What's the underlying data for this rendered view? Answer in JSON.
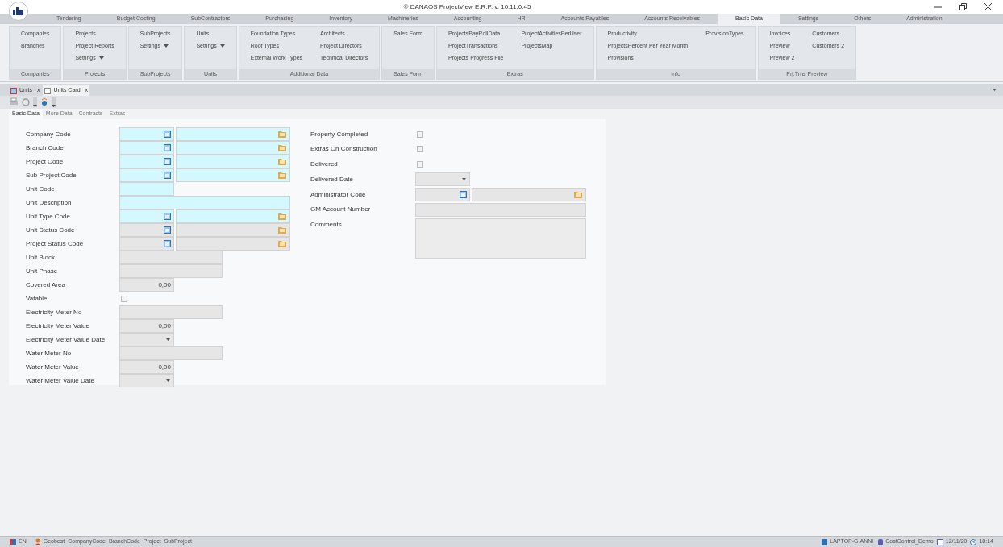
{
  "window": {
    "title": "© DANAOS ProjectView E.R.P. v. 10.11.0.45"
  },
  "menu_tabs": [
    {
      "label": "Tendering",
      "selected": false
    },
    {
      "label": "Budget Costing",
      "selected": false
    },
    {
      "label": "SubContractors",
      "selected": false
    },
    {
      "label": "Purchasing",
      "selected": false
    },
    {
      "label": "Inventory",
      "selected": false
    },
    {
      "label": "Machineries",
      "selected": false
    },
    {
      "label": "Accounting",
      "selected": false
    },
    {
      "label": "HR",
      "selected": false
    },
    {
      "label": "Accounts Payables",
      "selected": false
    },
    {
      "label": "Accounts Receivables",
      "selected": false
    },
    {
      "label": "Basic Data",
      "selected": true
    },
    {
      "label": "Settings",
      "selected": false
    },
    {
      "label": "Others",
      "selected": false
    },
    {
      "label": "Administration",
      "selected": false
    }
  ],
  "ribbon_groups": [
    {
      "label": "Companies",
      "columns": [
        [
          {
            "label": "Companies",
            "dropdown": false
          },
          {
            "label": "Branches",
            "dropdown": false
          }
        ]
      ]
    },
    {
      "label": "Projects",
      "columns": [
        [
          {
            "label": "Projects",
            "dropdown": false
          },
          {
            "label": "Project Reports",
            "dropdown": false
          },
          {
            "label": "Settings",
            "dropdown": true
          }
        ]
      ]
    },
    {
      "label": "SubProjects",
      "columns": [
        [
          {
            "label": "SubProjects",
            "dropdown": false
          },
          {
            "label": "Settings",
            "dropdown": true
          }
        ]
      ]
    },
    {
      "label": "Units",
      "columns": [
        [
          {
            "label": "Units",
            "dropdown": false
          },
          {
            "label": "Settings",
            "dropdown": true
          }
        ]
      ]
    },
    {
      "label": "Additional Data",
      "columns": [
        [
          {
            "label": "Foundation Types",
            "dropdown": false
          },
          {
            "label": "Roof Types",
            "dropdown": false
          },
          {
            "label": "External Work Types",
            "dropdown": false
          }
        ],
        [
          {
            "label": "Architects",
            "dropdown": false
          },
          {
            "label": "Project Directors",
            "dropdown": false
          },
          {
            "label": "Technical Directors",
            "dropdown": false
          }
        ]
      ]
    },
    {
      "label": "Sales Form",
      "columns": [
        [
          {
            "label": "Sales Form",
            "dropdown": false
          }
        ]
      ]
    },
    {
      "label": "Extras",
      "columns": [
        [
          {
            "label": "ProjectsPayRollData",
            "dropdown": false
          },
          {
            "label": "ProjectTransactions",
            "dropdown": false
          },
          {
            "label": "Projects Progress File",
            "dropdown": false
          }
        ],
        [
          {
            "label": "ProjectActivitiesPerUser",
            "dropdown": false
          },
          {
            "label": "ProjectsMap",
            "dropdown": false
          }
        ]
      ]
    },
    {
      "label": "Info",
      "columns": [
        [
          {
            "label": "Productivity",
            "dropdown": false
          },
          {
            "label": "ProjectsPercent Per Year Month",
            "dropdown": false
          },
          {
            "label": "Provisions",
            "dropdown": false
          }
        ],
        [
          {
            "label": "ProvisionTypes",
            "dropdown": false
          }
        ]
      ]
    },
    {
      "label": "Prj.Trns Preview",
      "columns": [
        [
          {
            "label": "Invoices",
            "dropdown": false
          },
          {
            "label": "Preview",
            "dropdown": false
          },
          {
            "label": "Preview 2",
            "dropdown": false
          }
        ],
        [
          {
            "label": "Customers",
            "dropdown": false
          },
          {
            "label": "Customers 2",
            "dropdown": false
          }
        ]
      ]
    }
  ],
  "document_tabs": [
    {
      "label": "Units",
      "selected": false,
      "close_mark": "x"
    },
    {
      "label": "Units Card",
      "selected": true,
      "close_mark": "x"
    }
  ],
  "form_tabs": [
    {
      "label": "Basic Data",
      "selected": true
    },
    {
      "label": "More Data",
      "selected": false
    },
    {
      "label": "Contracts",
      "selected": false
    },
    {
      "label": "Extras",
      "selected": false
    }
  ],
  "left_fields": [
    {
      "label": "Company Code",
      "kind": "lookup",
      "required": true
    },
    {
      "label": "Branch Code",
      "kind": "lookup",
      "required": true
    },
    {
      "label": "Project Code",
      "kind": "lookup",
      "required": true
    },
    {
      "label": "Sub Project Code",
      "kind": "lookup",
      "required": true
    },
    {
      "label": "Unit Code",
      "kind": "short",
      "required": true
    },
    {
      "label": "Unit Description",
      "kind": "full",
      "required": true
    },
    {
      "label": "Unit Type Code",
      "kind": "lookup",
      "required": true
    },
    {
      "label": "Unit Status Code",
      "kind": "lookup",
      "required": false
    },
    {
      "label": "Project Status Code",
      "kind": "lookup",
      "required": false
    },
    {
      "label": "Unit Block",
      "kind": "medium",
      "required": false
    },
    {
      "label": "Unit Phase",
      "kind": "medium",
      "required": false
    },
    {
      "label": "Covered Area",
      "kind": "number",
      "required": false,
      "value": "0,00"
    },
    {
      "label": "Vatable",
      "kind": "checkbox",
      "checked": false
    },
    {
      "label": "Electricity Meter No",
      "kind": "medium",
      "required": false
    },
    {
      "label": "Electricity Meter Value",
      "kind": "number",
      "required": false,
      "value": "0,00"
    },
    {
      "label": "Electricity Meter Value Date",
      "kind": "date",
      "required": false
    },
    {
      "label": "Water Meter No",
      "kind": "medium",
      "required": false
    },
    {
      "label": "Water Meter Value",
      "kind": "number",
      "required": false,
      "value": "0,00"
    },
    {
      "label": "Water Meter Value Date",
      "kind": "date",
      "required": false
    }
  ],
  "right_fields": [
    {
      "label": "Property Completed",
      "kind": "checkbox",
      "checked": false
    },
    {
      "label": "Extras On Construction",
      "kind": "checkbox",
      "checked": false
    },
    {
      "label": "Delivered",
      "kind": "checkbox",
      "checked": false
    },
    {
      "label": "Delivered Date",
      "kind": "date",
      "required": false
    },
    {
      "label": "Administrator Code",
      "kind": "lookup",
      "required": false
    },
    {
      "label": "GM Account Number",
      "kind": "full",
      "required": false
    },
    {
      "label": "Comments",
      "kind": "memo",
      "required": false
    }
  ],
  "status_bar": {
    "language": "EN",
    "user": "Geobest",
    "items": [
      "CompanyCode",
      "BranchCode",
      "Project",
      "SubProject"
    ],
    "computer": "LAPTOP-GIANNI",
    "database": "CostControl_Demo",
    "date": "12/11/20",
    "time": "18:14"
  }
}
